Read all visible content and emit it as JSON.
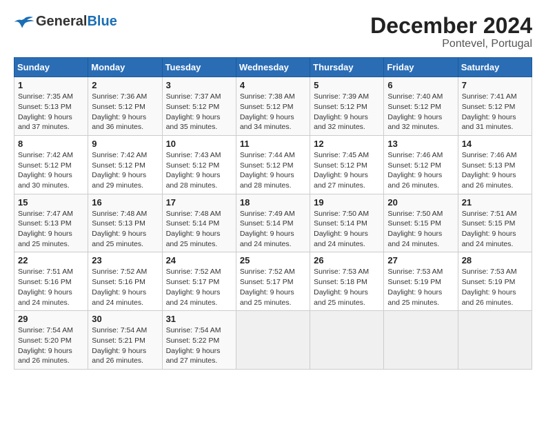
{
  "header": {
    "logo_general": "General",
    "logo_blue": "Blue",
    "title": "December 2024",
    "subtitle": "Pontevel, Portugal"
  },
  "weekdays": [
    "Sunday",
    "Monday",
    "Tuesday",
    "Wednesday",
    "Thursday",
    "Friday",
    "Saturday"
  ],
  "weeks": [
    [
      {
        "day": "1",
        "sunrise": "Sunrise: 7:35 AM",
        "sunset": "Sunset: 5:13 PM",
        "daylight": "Daylight: 9 hours and 37 minutes."
      },
      {
        "day": "2",
        "sunrise": "Sunrise: 7:36 AM",
        "sunset": "Sunset: 5:12 PM",
        "daylight": "Daylight: 9 hours and 36 minutes."
      },
      {
        "day": "3",
        "sunrise": "Sunrise: 7:37 AM",
        "sunset": "Sunset: 5:12 PM",
        "daylight": "Daylight: 9 hours and 35 minutes."
      },
      {
        "day": "4",
        "sunrise": "Sunrise: 7:38 AM",
        "sunset": "Sunset: 5:12 PM",
        "daylight": "Daylight: 9 hours and 34 minutes."
      },
      {
        "day": "5",
        "sunrise": "Sunrise: 7:39 AM",
        "sunset": "Sunset: 5:12 PM",
        "daylight": "Daylight: 9 hours and 32 minutes."
      },
      {
        "day": "6",
        "sunrise": "Sunrise: 7:40 AM",
        "sunset": "Sunset: 5:12 PM",
        "daylight": "Daylight: 9 hours and 32 minutes."
      },
      {
        "day": "7",
        "sunrise": "Sunrise: 7:41 AM",
        "sunset": "Sunset: 5:12 PM",
        "daylight": "Daylight: 9 hours and 31 minutes."
      }
    ],
    [
      {
        "day": "8",
        "sunrise": "Sunrise: 7:42 AM",
        "sunset": "Sunset: 5:12 PM",
        "daylight": "Daylight: 9 hours and 30 minutes."
      },
      {
        "day": "9",
        "sunrise": "Sunrise: 7:42 AM",
        "sunset": "Sunset: 5:12 PM",
        "daylight": "Daylight: 9 hours and 29 minutes."
      },
      {
        "day": "10",
        "sunrise": "Sunrise: 7:43 AM",
        "sunset": "Sunset: 5:12 PM",
        "daylight": "Daylight: 9 hours and 28 minutes."
      },
      {
        "day": "11",
        "sunrise": "Sunrise: 7:44 AM",
        "sunset": "Sunset: 5:12 PM",
        "daylight": "Daylight: 9 hours and 28 minutes."
      },
      {
        "day": "12",
        "sunrise": "Sunrise: 7:45 AM",
        "sunset": "Sunset: 5:12 PM",
        "daylight": "Daylight: 9 hours and 27 minutes."
      },
      {
        "day": "13",
        "sunrise": "Sunrise: 7:46 AM",
        "sunset": "Sunset: 5:12 PM",
        "daylight": "Daylight: 9 hours and 26 minutes."
      },
      {
        "day": "14",
        "sunrise": "Sunrise: 7:46 AM",
        "sunset": "Sunset: 5:13 PM",
        "daylight": "Daylight: 9 hours and 26 minutes."
      }
    ],
    [
      {
        "day": "15",
        "sunrise": "Sunrise: 7:47 AM",
        "sunset": "Sunset: 5:13 PM",
        "daylight": "Daylight: 9 hours and 25 minutes."
      },
      {
        "day": "16",
        "sunrise": "Sunrise: 7:48 AM",
        "sunset": "Sunset: 5:13 PM",
        "daylight": "Daylight: 9 hours and 25 minutes."
      },
      {
        "day": "17",
        "sunrise": "Sunrise: 7:48 AM",
        "sunset": "Sunset: 5:14 PM",
        "daylight": "Daylight: 9 hours and 25 minutes."
      },
      {
        "day": "18",
        "sunrise": "Sunrise: 7:49 AM",
        "sunset": "Sunset: 5:14 PM",
        "daylight": "Daylight: 9 hours and 24 minutes."
      },
      {
        "day": "19",
        "sunrise": "Sunrise: 7:50 AM",
        "sunset": "Sunset: 5:14 PM",
        "daylight": "Daylight: 9 hours and 24 minutes."
      },
      {
        "day": "20",
        "sunrise": "Sunrise: 7:50 AM",
        "sunset": "Sunset: 5:15 PM",
        "daylight": "Daylight: 9 hours and 24 minutes."
      },
      {
        "day": "21",
        "sunrise": "Sunrise: 7:51 AM",
        "sunset": "Sunset: 5:15 PM",
        "daylight": "Daylight: 9 hours and 24 minutes."
      }
    ],
    [
      {
        "day": "22",
        "sunrise": "Sunrise: 7:51 AM",
        "sunset": "Sunset: 5:16 PM",
        "daylight": "Daylight: 9 hours and 24 minutes."
      },
      {
        "day": "23",
        "sunrise": "Sunrise: 7:52 AM",
        "sunset": "Sunset: 5:16 PM",
        "daylight": "Daylight: 9 hours and 24 minutes."
      },
      {
        "day": "24",
        "sunrise": "Sunrise: 7:52 AM",
        "sunset": "Sunset: 5:17 PM",
        "daylight": "Daylight: 9 hours and 24 minutes."
      },
      {
        "day": "25",
        "sunrise": "Sunrise: 7:52 AM",
        "sunset": "Sunset: 5:17 PM",
        "daylight": "Daylight: 9 hours and 25 minutes."
      },
      {
        "day": "26",
        "sunrise": "Sunrise: 7:53 AM",
        "sunset": "Sunset: 5:18 PM",
        "daylight": "Daylight: 9 hours and 25 minutes."
      },
      {
        "day": "27",
        "sunrise": "Sunrise: 7:53 AM",
        "sunset": "Sunset: 5:19 PM",
        "daylight": "Daylight: 9 hours and 25 minutes."
      },
      {
        "day": "28",
        "sunrise": "Sunrise: 7:53 AM",
        "sunset": "Sunset: 5:19 PM",
        "daylight": "Daylight: 9 hours and 26 minutes."
      }
    ],
    [
      {
        "day": "29",
        "sunrise": "Sunrise: 7:54 AM",
        "sunset": "Sunset: 5:20 PM",
        "daylight": "Daylight: 9 hours and 26 minutes."
      },
      {
        "day": "30",
        "sunrise": "Sunrise: 7:54 AM",
        "sunset": "Sunset: 5:21 PM",
        "daylight": "Daylight: 9 hours and 26 minutes."
      },
      {
        "day": "31",
        "sunrise": "Sunrise: 7:54 AM",
        "sunset": "Sunset: 5:22 PM",
        "daylight": "Daylight: 9 hours and 27 minutes."
      },
      null,
      null,
      null,
      null
    ]
  ]
}
